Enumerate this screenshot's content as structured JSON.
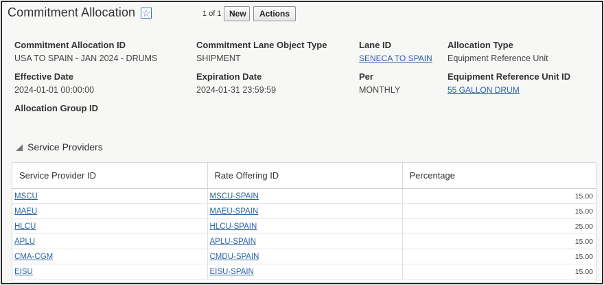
{
  "page": {
    "title": "Commitment Allocation",
    "pager": "1 of 1",
    "new_label": "New",
    "actions_label": "Actions"
  },
  "fields": {
    "commitment_allocation_id": {
      "label": "Commitment Allocation ID",
      "value": "USA TO SPAIN - JAN 2024 - DRUMS"
    },
    "lane_object_type": {
      "label": "Commitment Lane Object Type",
      "value": "SHIPMENT"
    },
    "lane_id": {
      "label": "Lane ID",
      "value": "SENECA TO SPAIN"
    },
    "allocation_type": {
      "label": "Allocation Type",
      "value": "Equipment Reference Unit"
    },
    "effective_date": {
      "label": "Effective Date",
      "value": "2024-01-01 00:00:00"
    },
    "expiration_date": {
      "label": "Expiration Date",
      "value": "2024-01-31 23:59:59"
    },
    "per": {
      "label": "Per",
      "value": "MONTHLY"
    },
    "equipment_ref_unit_id": {
      "label": "Equipment Reference Unit ID",
      "value": "55 GALLON DRUM"
    },
    "allocation_group_id": {
      "label": "Allocation Group ID",
      "value": ""
    }
  },
  "service_providers": {
    "section_title": "Service Providers",
    "columns": [
      "Service Provider ID",
      "Rate Offering ID",
      "Percentage"
    ],
    "rows": [
      {
        "provider": "MSCU",
        "rate": "MSCU-SPAIN",
        "pct": "15.00"
      },
      {
        "provider": "MAEU",
        "rate": "MAEU-SPAIN",
        "pct": "15.00"
      },
      {
        "provider": "HLCU",
        "rate": "HLCU-SPAIN",
        "pct": "25.00"
      },
      {
        "provider": "APLU",
        "rate": "APLU-SPAIN",
        "pct": "15.00"
      },
      {
        "provider": "CMA-CGM",
        "rate": "CMDU-SPAIN",
        "pct": "15.00"
      },
      {
        "provider": "EISU",
        "rate": "EISU-SPAIN",
        "pct": "15.00"
      }
    ]
  },
  "colors": {
    "link": "#2a63a5",
    "border": "#2b2b2b",
    "panel_bg": "#f7f7f6"
  }
}
